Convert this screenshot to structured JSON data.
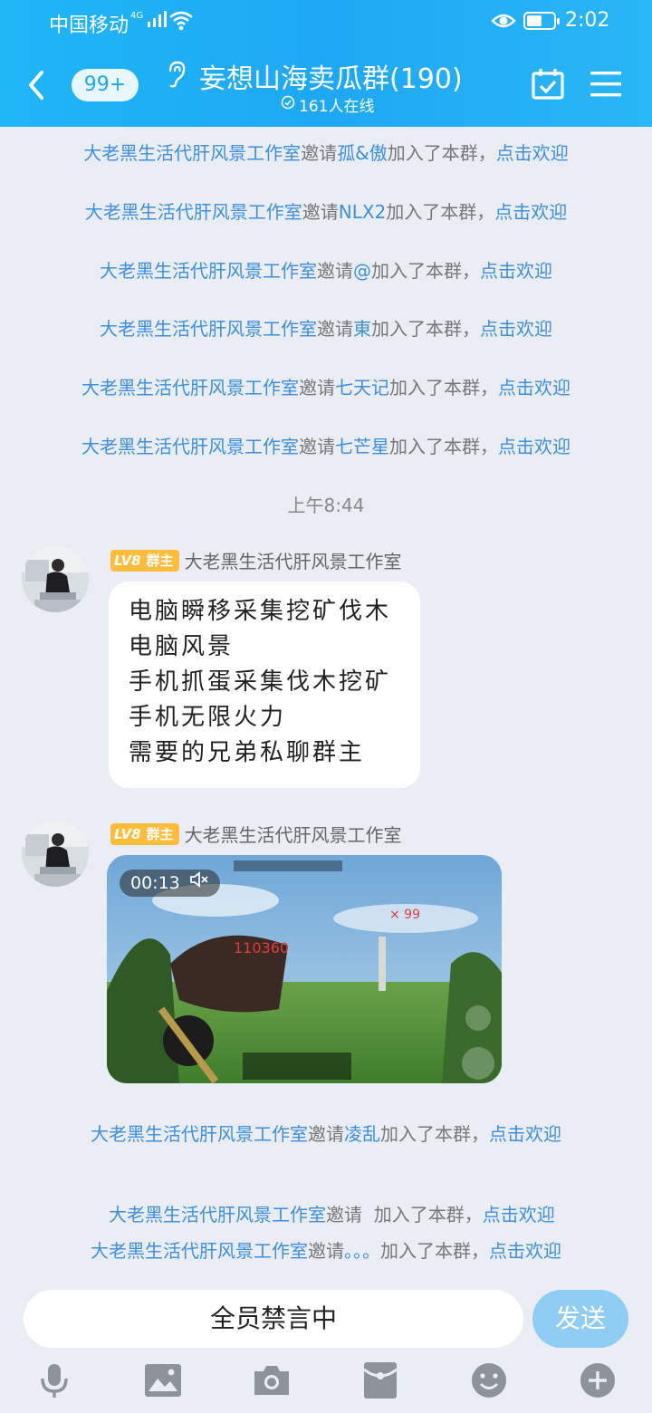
{
  "status_bar": {
    "carrier": "中国移动",
    "network": "4G",
    "time": "2:02"
  },
  "header": {
    "unread": "99+",
    "title": "妄想山海卖瓜群(190)",
    "online": "161人在线"
  },
  "system_messages_top": [
    {
      "inviter": "大老黑生活代肝风景工作室",
      "verb": "邀请",
      "name": "孤&傲",
      "suffix": "加入了本群，",
      "link": "点击欢迎"
    },
    {
      "inviter": "大老黑生活代肝风景工作室",
      "verb": "邀请",
      "name": "NLX2",
      "suffix": "加入了本群，",
      "link": "点击欢迎"
    },
    {
      "inviter": "大老黑生活代肝风景工作室",
      "verb": "邀请",
      "name": "@",
      "suffix": "加入了本群，",
      "link": "点击欢迎"
    },
    {
      "inviter": "大老黑生活代肝风景工作室",
      "verb": "邀请",
      "name": "東",
      "suffix": "加入了本群，",
      "link": "点击欢迎"
    },
    {
      "inviter": "大老黑生活代肝风景工作室",
      "verb": "邀请",
      "name": "七天记",
      "suffix": "加入了本群，",
      "link": "点击欢迎"
    },
    {
      "inviter": "大老黑生活代肝风景工作室",
      "verb": "邀请",
      "name": "七芒星",
      "suffix": "加入了本群，",
      "link": "点击欢迎"
    }
  ],
  "timestamp": "上午8:44",
  "messages": [
    {
      "level": "LV8",
      "role": "群主",
      "sender": "大老黑生活代肝风景工作室",
      "lines": [
        "电脑瞬移采集挖矿伐木",
        "电脑风景",
        "手机抓蛋采集伐木挖矿",
        "手机无限火力",
        "需要的兄弟私聊群主"
      ]
    },
    {
      "level": "LV8",
      "role": "群主",
      "sender": "大老黑生活代肝风景工作室",
      "video_duration": "00:13"
    }
  ],
  "system_messages_bottom": [
    {
      "inviter": "大老黑生活代肝风景工作室",
      "verb": "邀请",
      "name": "凌乱",
      "suffix": "加入了本群，",
      "link": "点击欢迎"
    },
    {
      "inviter": "大老黑生活代肝风景工作室",
      "verb": "邀请",
      "name": "  ",
      "suffix": "加入了本群，",
      "link": "点击欢迎"
    },
    {
      "inviter": "大老黑生活代肝风景工作室",
      "verb": "邀请",
      "name": "。。。",
      "suffix": "加入了本群，",
      "link": "点击欢迎"
    }
  ],
  "input": {
    "placeholder": "全员禁言中",
    "send_label": "发送"
  },
  "toolbar": [
    "microphone-icon",
    "image-icon",
    "camera-icon",
    "red-envelope-icon",
    "emoji-icon",
    "plus-icon"
  ],
  "colors": {
    "header": "#1ea8f4",
    "link": "#3d8fe0",
    "badge": "#fdbd3a",
    "send": "#8fcdf5",
    "background": "#eaedf4"
  }
}
